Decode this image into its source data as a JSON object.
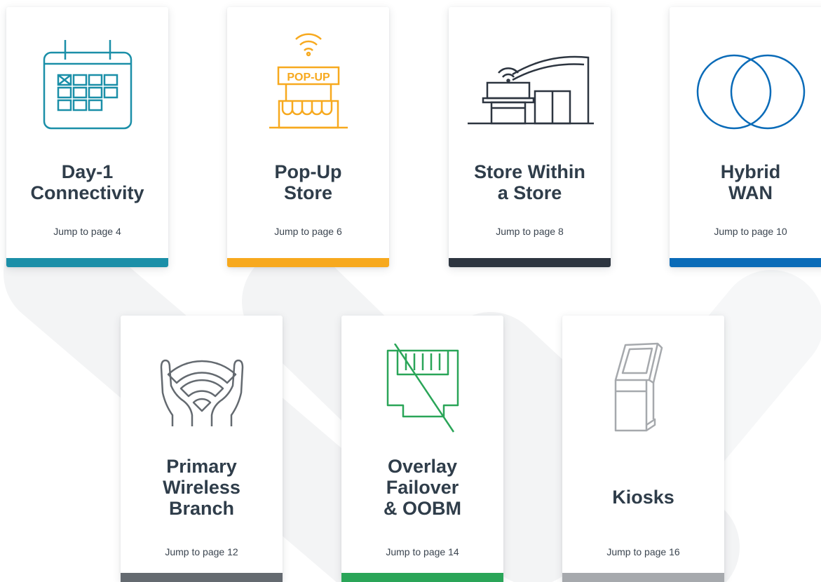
{
  "cards": [
    {
      "title_lines": [
        "Day-1",
        "Connectivity"
      ],
      "link": "Jump to page 4",
      "accent": "#1b8fa8",
      "icon": "calendar-icon"
    },
    {
      "title_lines": [
        "Pop-Up",
        "Store"
      ],
      "link": "Jump to page 6",
      "accent": "#f7a91e",
      "icon": "pop-up-store-icon",
      "icon_text": "POP-UP"
    },
    {
      "title_lines": [
        "Store Within",
        "a Store"
      ],
      "link": "Jump to page 8",
      "accent": "#2d3540",
      "icon": "store-within-store-icon"
    },
    {
      "title_lines": [
        "Hybrid",
        "WAN"
      ],
      "link": "Jump to page 10",
      "accent": "#0a6bb8",
      "icon": "overlapping-circles-icon"
    },
    {
      "title_lines": [
        "Primary",
        "Wireless",
        "Branch"
      ],
      "link": "Jump to page 12",
      "accent": "#646a70",
      "icon": "wifi-hands-icon"
    },
    {
      "title_lines": [
        "Overlay",
        "Failover",
        "& OOBM"
      ],
      "link": "Jump to page 14",
      "accent": "#2aa558",
      "icon": "ethernet-port-crossed-icon"
    },
    {
      "title_lines": [
        "Kiosks"
      ],
      "link": "Jump to page 16",
      "accent": "#a6a9ad",
      "icon": "kiosk-icon"
    }
  ]
}
